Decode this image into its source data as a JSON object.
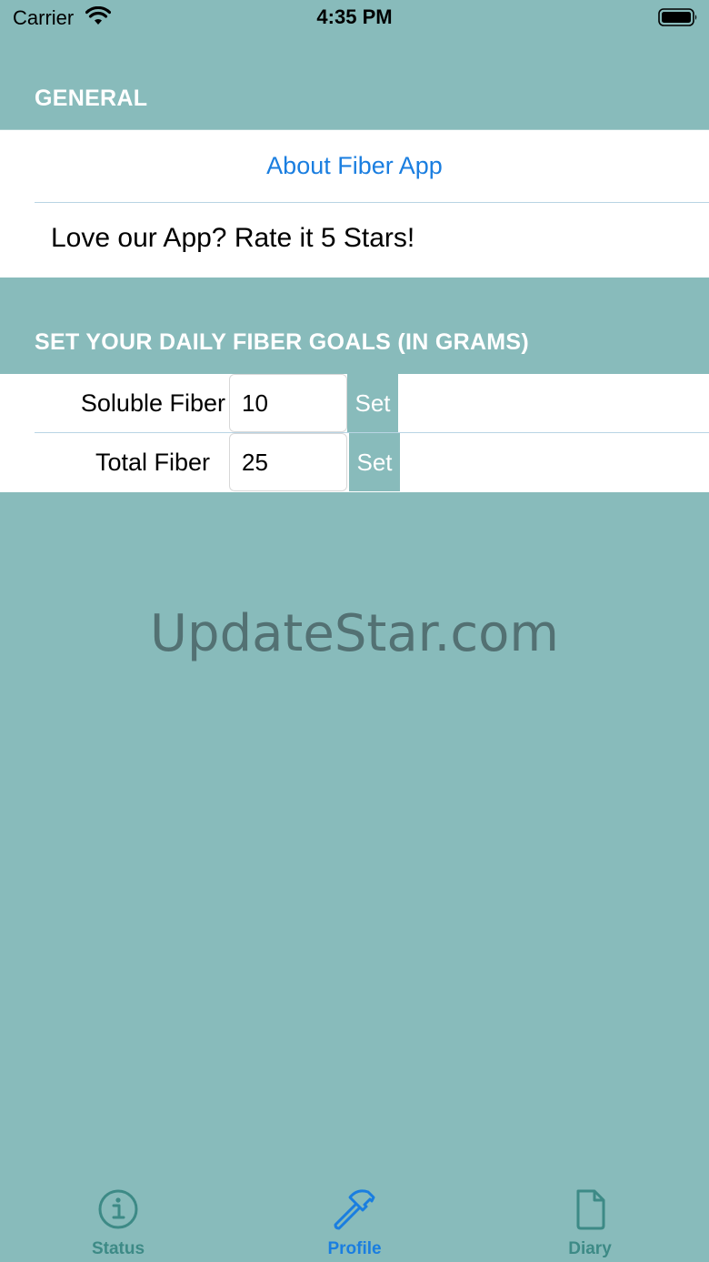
{
  "status_bar": {
    "carrier": "Carrier",
    "time": "4:35 PM"
  },
  "general": {
    "header": "GENERAL",
    "about_label": "About Fiber App",
    "rate_label": "Love our App? Rate it 5 Stars!"
  },
  "goals": {
    "header": "SET YOUR DAILY FIBER GOALS (IN GRAMS)",
    "rows": [
      {
        "label": "Soluble Fiber",
        "value": "10",
        "button": "Set"
      },
      {
        "label": "Total Fiber",
        "value": "25",
        "button": "Set"
      }
    ]
  },
  "watermark": "UpdateStar.com",
  "tabs": [
    {
      "label": "Status",
      "icon": "info-icon",
      "active": false
    },
    {
      "label": "Profile",
      "icon": "hammer-icon",
      "active": true
    },
    {
      "label": "Diary",
      "icon": "document-icon",
      "active": false
    }
  ],
  "colors": {
    "background": "#88BBBB",
    "link": "#1a7ee0",
    "tab_inactive": "#3d8a86",
    "tab_active": "#1a7ee0"
  }
}
